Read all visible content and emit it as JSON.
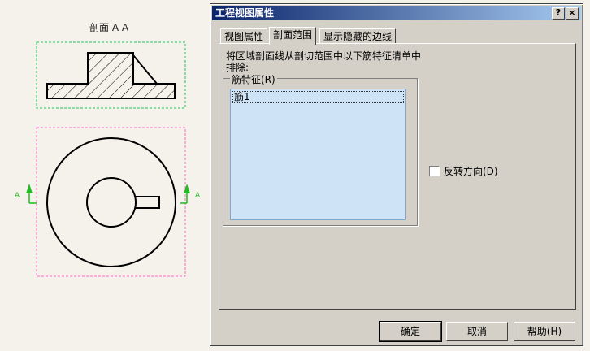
{
  "drawing": {
    "section_label": "剖面 A-A",
    "arrow_label_left": "A",
    "arrow_label_right": "A"
  },
  "dialog": {
    "title": "工程视图属性",
    "help_icon_text": "?",
    "close_icon_text": "×",
    "tabs": [
      {
        "label": "视图属性",
        "active": false
      },
      {
        "label": "剖面范围",
        "active": true
      },
      {
        "label": "显示隐藏的边线",
        "active": false
      }
    ],
    "description": "将区域剖面线从剖切范围中以下筋特征清单中排除:",
    "group_label": "筋特征(R)",
    "list_items": [
      "筋1"
    ],
    "checkbox": {
      "label": "反转方向(D)",
      "checked": false
    },
    "buttons": {
      "ok": "确定",
      "cancel": "取消",
      "help": "帮助(H)"
    }
  },
  "colors": {
    "title_bar_start": "#0a246a",
    "title_bar_end": "#a6caf0",
    "dialog_face": "#d4d0c8",
    "list_background": "#cfe3f6",
    "section_frame": "#22c55e",
    "view_frame": "#ff66cc",
    "arrow_green": "#22bb22"
  }
}
